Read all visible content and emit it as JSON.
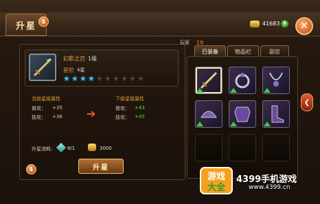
{
  "header": {
    "title": "升星",
    "title_badge": "1",
    "gold_amount": "41683",
    "add_label": "+",
    "close_label": "✕"
  },
  "item": {
    "name": "幻影之刃",
    "level": "1级",
    "star_label": "星阶",
    "star_count": "4星",
    "stars_total": 10,
    "stars_lit": 4
  },
  "attributes": {
    "current_title": "当前星级属性",
    "next_title": "下级星级属性",
    "rows": [
      {
        "label": "普攻：",
        "current": "+35",
        "next": "+43"
      },
      {
        "label": "技攻：",
        "current": "+36",
        "next": "+45"
      }
    ]
  },
  "cost": {
    "label": "升星消耗:",
    "gem_value": "8/1",
    "gold_value": "3000"
  },
  "upgrade_button": "升星",
  "bottom_badge": "1",
  "player": {
    "label": "玩家",
    "bracket": "【龙"
  },
  "tabs": [
    {
      "label": "已装备",
      "active": true
    },
    {
      "label": "物品栏",
      "active": false
    },
    {
      "label": "副官",
      "active": false
    }
  ],
  "equipment": [
    {
      "icon": "sword-icon",
      "filled": true,
      "selected": true
    },
    {
      "icon": "ring-icon",
      "filled": true,
      "selected": false
    },
    {
      "icon": "necklace-icon",
      "filled": true,
      "selected": false
    },
    {
      "icon": "helmet-icon",
      "filled": true,
      "selected": false
    },
    {
      "icon": "armor-icon",
      "filled": true,
      "selected": false
    },
    {
      "icon": "boots-icon",
      "filled": true,
      "selected": false
    },
    {
      "icon": "empty-slot",
      "filled": false,
      "selected": false
    },
    {
      "icon": "empty-slot",
      "filled": false,
      "selected": false
    },
    {
      "icon": "empty-slot",
      "filled": false,
      "selected": false
    }
  ],
  "watermark": {
    "logo_line1": "游戏",
    "logo_line2": "大全",
    "site_name": "4399手机游戏",
    "url": "www.4399.cn"
  },
  "colors": {
    "accent_gold": "#f0b050",
    "stat_up": "#50e040",
    "star_lit": "#4ab8f0"
  }
}
